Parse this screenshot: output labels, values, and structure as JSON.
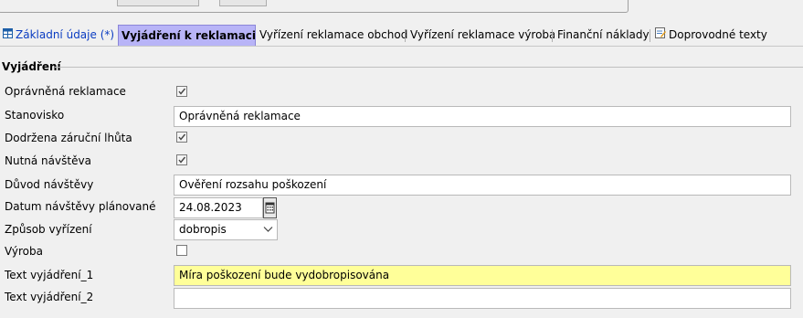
{
  "tabs": [
    {
      "label": "Základní údaje  (*)",
      "icon": "table-icon",
      "active": false
    },
    {
      "label": "Vyjádření k reklamaci",
      "active": true
    },
    {
      "label": "Vyřízení reklamace obchod",
      "active": false
    },
    {
      "label": "Vyřízení reklamace výroba",
      "active": false
    },
    {
      "label": "Finanční náklady",
      "active": false
    },
    {
      "label": "Doprovodné texty",
      "icon": "edit-document-icon",
      "active": false
    }
  ],
  "group": {
    "title": "Vyjádření"
  },
  "fields": {
    "opravnena": {
      "label": "Oprávněná reklamace",
      "checked": true
    },
    "stanovisko": {
      "label": "Stanovisko",
      "value": "Oprávněná reklamace"
    },
    "dodrzena": {
      "label": "Dodržena záruční lhůta",
      "checked": true
    },
    "nutna": {
      "label": "Nutná návštěva",
      "checked": true
    },
    "duvod": {
      "label": "Důvod návštěvy",
      "value": "Ověření rozsahu poškození"
    },
    "datum": {
      "label": "Datum návštěvy plánované",
      "value": "24.08.2023"
    },
    "zpusob": {
      "label": "Způsob vyřízení",
      "value": "dobropis"
    },
    "vyroba": {
      "label": "Výroba",
      "checked": false
    },
    "text1": {
      "label": "Text vyjádření_1",
      "value": "Míra poškození bude vydobropisována"
    },
    "text2": {
      "label": "Text vyjádření_2",
      "value": ""
    }
  },
  "colors": {
    "active_tab": "#b8b4f7",
    "highlight_field": "#ffff99",
    "link_tab": "#0a3cc2"
  }
}
